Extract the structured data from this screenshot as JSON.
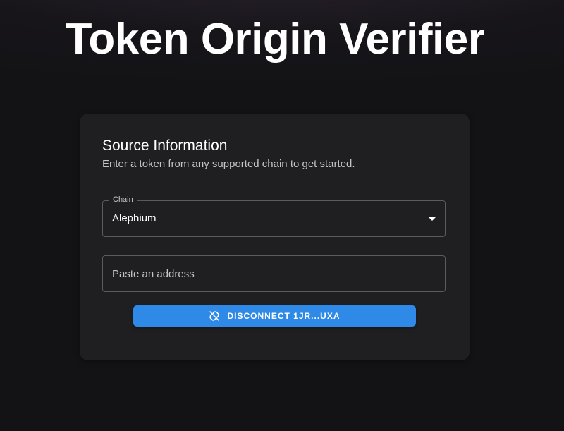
{
  "page": {
    "title": "Token Origin Verifier"
  },
  "card": {
    "title": "Source Information",
    "subtitle": "Enter a token from any supported chain to get started.",
    "chain_field": {
      "label": "Chain",
      "value": "Alephium",
      "icon": "chevron-down-icon"
    },
    "address_field": {
      "placeholder": "Paste an address",
      "value": ""
    },
    "disconnect_button": {
      "label": "DISCONNECT 1JR...UXA",
      "icon": "link-off-icon"
    }
  },
  "colors": {
    "background": "#131316",
    "card": "#1f1f22",
    "accent": "#2e8ae6",
    "border": "#5a5a60",
    "muted_text": "#c4c4c8"
  }
}
